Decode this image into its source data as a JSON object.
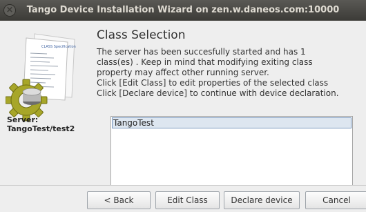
{
  "window": {
    "title": "Tango Device Installation Wizard on zen.w.daneos.com:10000",
    "close_glyph": "×"
  },
  "side": {
    "document_icon": "document-icon",
    "gear_icon": "gear-icon",
    "doc_caption": "CLASS Specification",
    "server_label": "Server:",
    "server_value": "TangoTest/test2"
  },
  "main": {
    "heading": "Class Selection",
    "description_lines": [
      "The server has been succesfully started and has 1",
      "class(es) . Keep in mind that modifying exiting class",
      "property may affect other running server.",
      "Click [Edit Class] to edit properties of the selected class",
      "Click [Declare device] to continue with device declaration."
    ],
    "class_list": {
      "items": [
        "TangoTest"
      ],
      "selected": "TangoTest"
    }
  },
  "footer": {
    "back": "< Back",
    "edit_class": "Edit Class",
    "declare_device": "Declare device",
    "cancel": "Cancel"
  }
}
